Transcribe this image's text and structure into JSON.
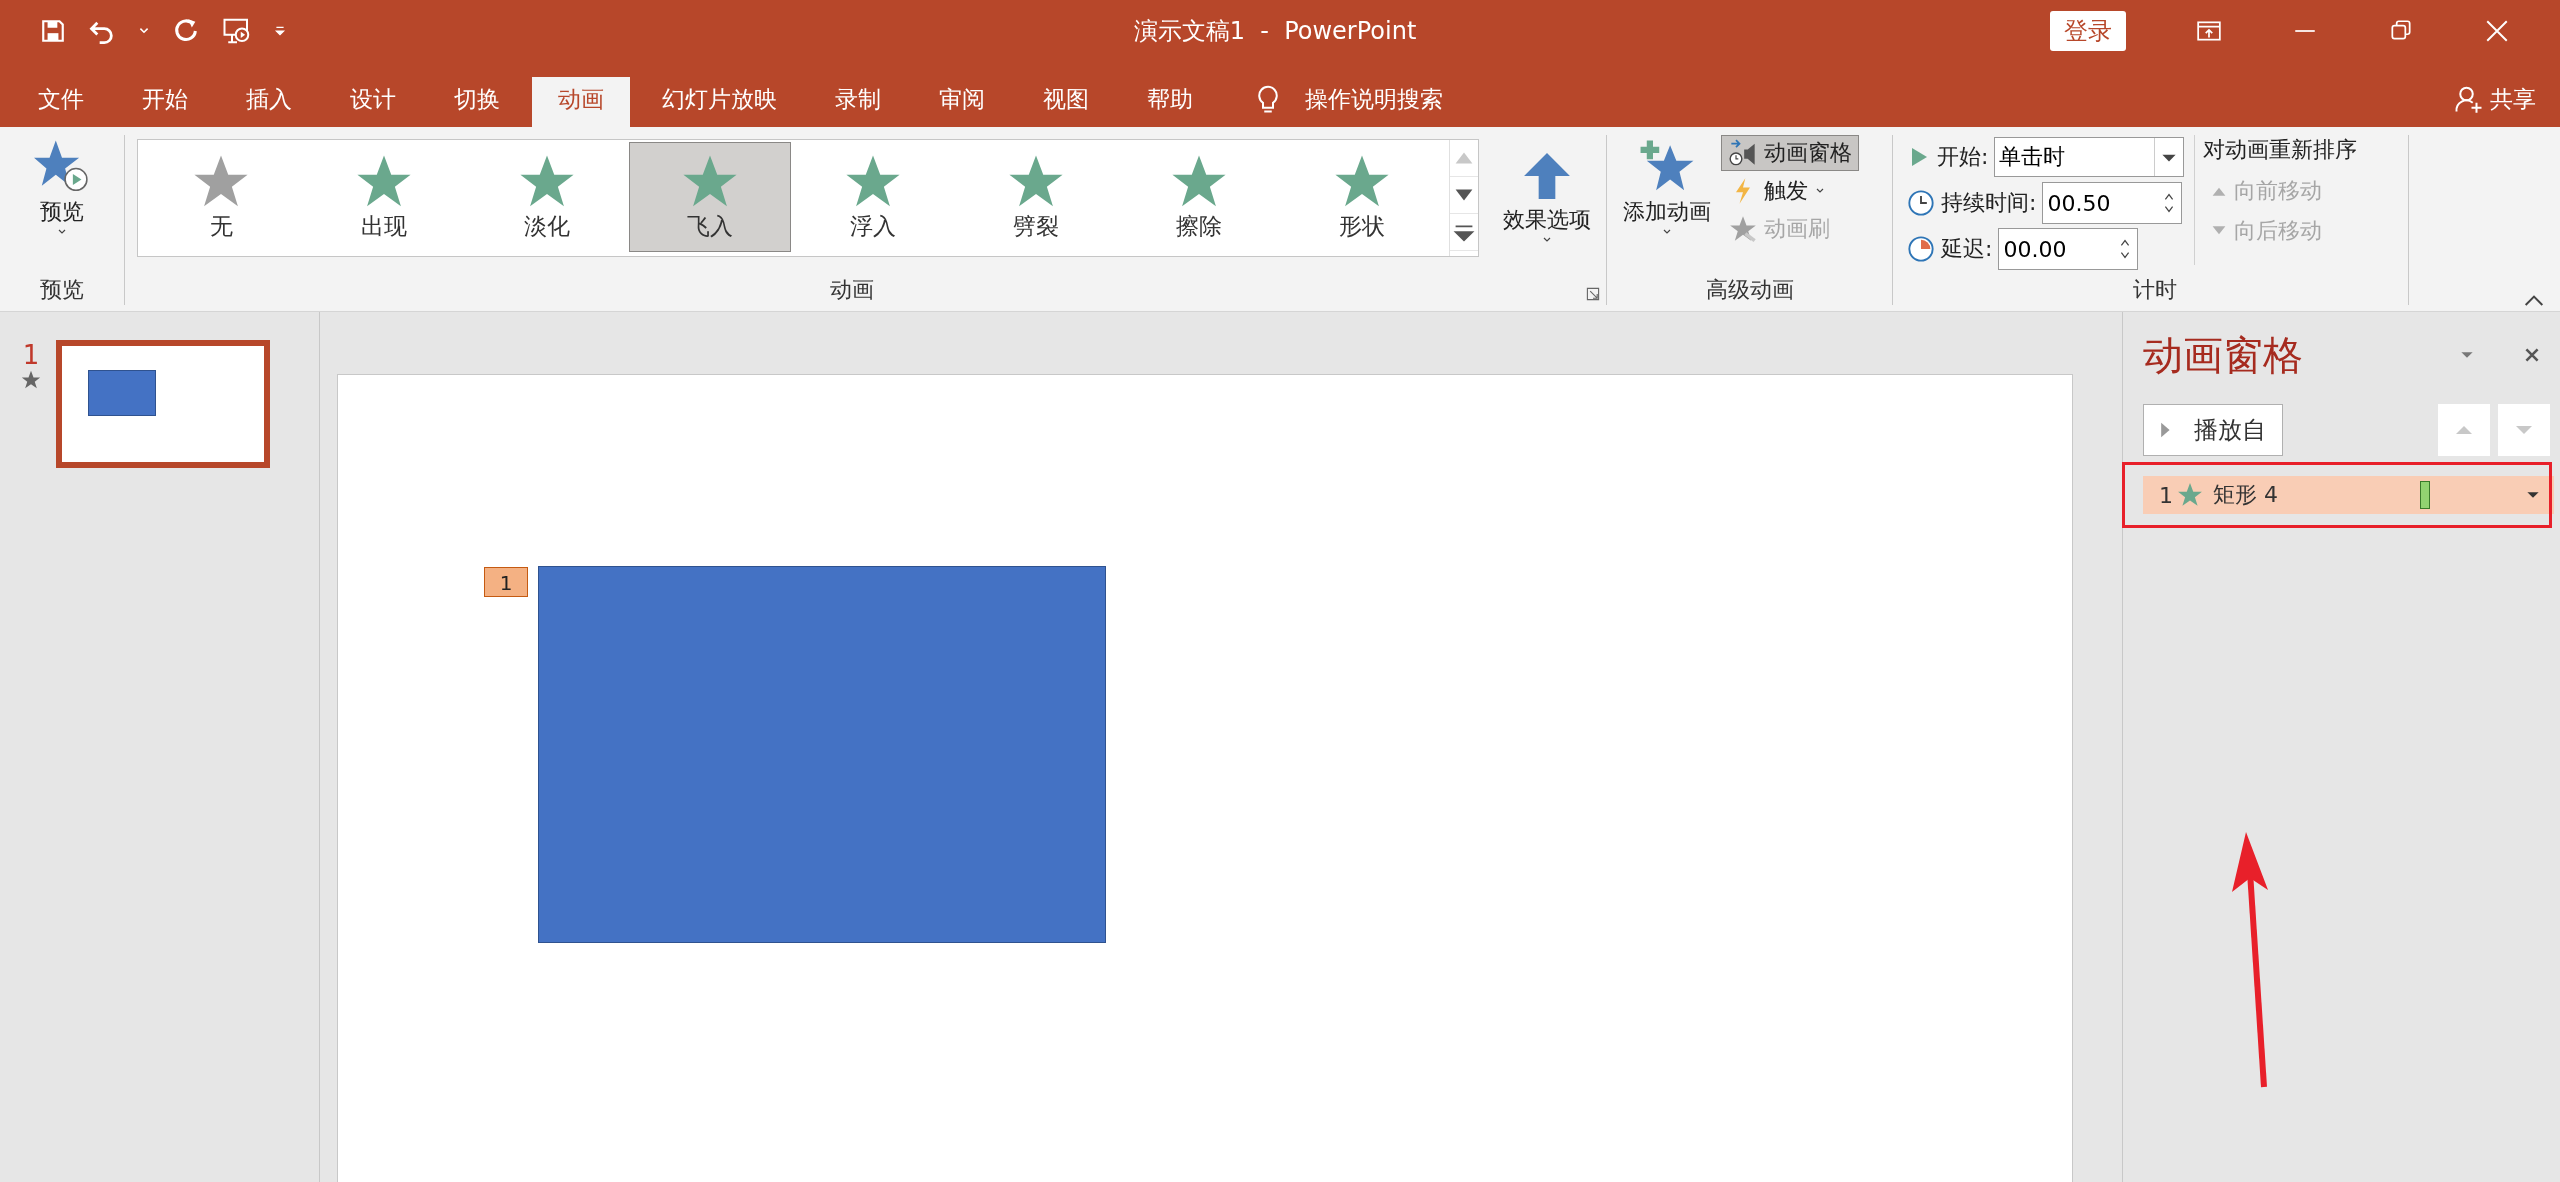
{
  "title_bar": {
    "title": "演示文稿1  -  PowerPoint",
    "login_button": "登录"
  },
  "tabs": [
    {
      "label": "文件",
      "selected": false
    },
    {
      "label": "开始",
      "selected": false
    },
    {
      "label": "插入",
      "selected": false
    },
    {
      "label": "设计",
      "selected": false
    },
    {
      "label": "切换",
      "selected": false
    },
    {
      "label": "动画",
      "selected": true
    },
    {
      "label": "幻灯片放映",
      "selected": false
    },
    {
      "label": "录制",
      "selected": false
    },
    {
      "label": "审阅",
      "selected": false
    },
    {
      "label": "视图",
      "selected": false
    },
    {
      "label": "帮助",
      "selected": false
    }
  ],
  "tell_me": "操作说明搜索",
  "share": "共享",
  "ribbon": {
    "preview": {
      "button": "预览",
      "group_label": "预览"
    },
    "animations": {
      "items": [
        {
          "label": "无",
          "selected": false
        },
        {
          "label": "出现",
          "selected": false
        },
        {
          "label": "淡化",
          "selected": false
        },
        {
          "label": "飞入",
          "selected": true
        },
        {
          "label": "浮入",
          "selected": false
        },
        {
          "label": "劈裂",
          "selected": false
        },
        {
          "label": "擦除",
          "selected": false
        },
        {
          "label": "形状",
          "selected": false
        }
      ],
      "effect_options": "效果选项",
      "group_label": "动画"
    },
    "advanced": {
      "add_animation": "添加动画",
      "animation_pane": {
        "label": "动画窗格",
        "selected": true
      },
      "trigger": {
        "label": "触发",
        "disabled": false
      },
      "painter": {
        "label": "动画刷",
        "disabled": true
      },
      "group_label": "高级动画"
    },
    "timing": {
      "start_label": "开始:",
      "start_value": "单击时",
      "duration_label": "持续时间:",
      "duration_value": "00.50",
      "delay_label": "延迟:",
      "delay_value": "00.00",
      "reorder_title": "对动画重新排序",
      "move_earlier": {
        "label": "向前移动",
        "disabled": true
      },
      "move_later": {
        "label": "向后移动",
        "disabled": true
      },
      "group_label": "计时"
    }
  },
  "thumbnails": [
    {
      "number": "1",
      "selected": true,
      "has_animation": true
    }
  ],
  "slide": {
    "animation_tags": [
      {
        "label": "1"
      }
    ]
  },
  "animation_pane": {
    "title": "动画窗格",
    "play_button": "播放自",
    "items": [
      {
        "number": "1",
        "name": "矩形 4",
        "selected": true
      }
    ]
  }
}
